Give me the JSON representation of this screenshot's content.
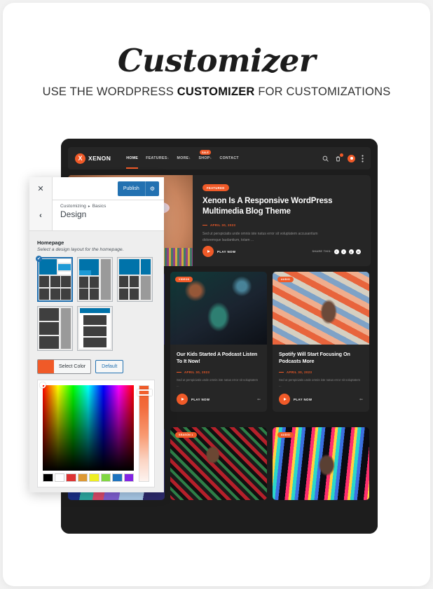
{
  "heading": {
    "title": "Customizer",
    "subtitle_pre": "USE THE WORDPRESS ",
    "subtitle_bold": "CUSTOMIZER",
    "subtitle_post": " FOR CUSTOMIZATIONS"
  },
  "customizer": {
    "close_icon": "close-icon",
    "publish_label": "Publish",
    "gear_icon": "gear-icon",
    "back_icon": "chevron-left-icon",
    "breadcrumb_root": "Customizing",
    "breadcrumb_sep": "▸",
    "breadcrumb_current": "Basics",
    "section_title": "Design",
    "control_label": "Homepage",
    "control_desc": "Select a design layout for the homepage.",
    "selected_check": "✔",
    "layouts": [
      {
        "name": "layout-1",
        "selected": true
      },
      {
        "name": "layout-2",
        "selected": false
      },
      {
        "name": "layout-3",
        "selected": false
      },
      {
        "name": "layout-4",
        "selected": false
      },
      {
        "name": "layout-5",
        "selected": false
      }
    ],
    "color_control": {
      "swatch_color": "#f05a28",
      "select_label": "Select Color",
      "default_label": "Default",
      "presets": [
        "#000000",
        "#ffffff",
        "#dd3333",
        "#dd9933",
        "#eeee22",
        "#81d742",
        "#1e73be",
        "#8224e3"
      ]
    }
  },
  "site": {
    "logo_letter": "X",
    "logo_text": "XENON",
    "nav": [
      {
        "label": "HOME",
        "active": true,
        "caret": "",
        "badge": ""
      },
      {
        "label": "FEATURES",
        "active": false,
        "caret": "↓",
        "badge": ""
      },
      {
        "label": "MORE",
        "active": false,
        "caret": "↓",
        "badge": ""
      },
      {
        "label": "SHOP",
        "active": false,
        "caret": "↓",
        "badge": "SALE"
      },
      {
        "label": "CONTACT",
        "active": false,
        "caret": "",
        "badge": ""
      }
    ],
    "icons": [
      "search-icon",
      "cart-icon",
      "user-icon",
      "more-vertical-icon"
    ],
    "hero": {
      "badge": "FEATURED",
      "title": "Xenon Is A Responsive WordPress Multimedia Blog Theme",
      "date": "APRIL 30, 2023",
      "excerpt": "Sed ut perspiciatis unde omnis iste natus error sit voluptatem accusantium doloremque laudantium, totam ...",
      "play_label": "PLAY NOW",
      "share_label": "SHARE THIS:",
      "share_icons": [
        "f",
        "t",
        "g",
        "m"
      ]
    },
    "cards_row2": [
      {
        "badge": "VIDEOS",
        "title": "Our Kids Started A Podcast Listen To It Now!",
        "date": "APRIL 30, 2023",
        "excerpt": "Sed ut perspiciatis unde omnis iste natus error sit voluptatem ...",
        "play_label": "PLAY NOW"
      },
      {
        "badge": "AUDIO",
        "title": "Spotify Will Start Focusing On Podcasts More",
        "date": "APRIL 30, 2023",
        "excerpt": "Sed ut perspiciatis unde omnis iste natus error sit voluptatem ...",
        "play_label": "PLAY NOW"
      }
    ],
    "cards_row3": [
      {
        "badge": ""
      },
      {
        "badge": "SEASON 1"
      },
      {
        "badge": "AUDIO"
      }
    ]
  },
  "colors": {
    "accent": "#f05a28",
    "wp_blue": "#2271b1",
    "dark_bg": "#1d1d1d",
    "card_bg": "#262626"
  }
}
